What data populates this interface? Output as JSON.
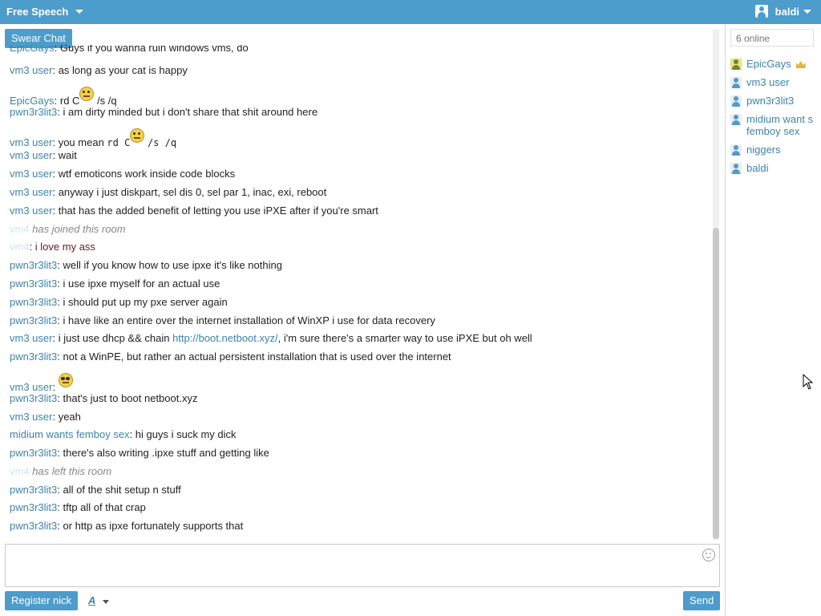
{
  "header": {
    "room_name": "Free Speech",
    "username": "baldi"
  },
  "chat": {
    "swear_button_label": "Swear Chat",
    "messages": [
      {
        "nick": "EpicGays",
        "text": "Guys if you wanna ruin windows vms, do"
      },
      {
        "nick": "vm3 user",
        "text": "as long as your cat is happy"
      },
      {
        "nick": "EpicGays",
        "text_before": "rd C",
        "text_after": "/s /q",
        "emoji": "confused-smiley"
      },
      {
        "nick": "pwn3r3lit3",
        "text": "i am dirty minded but i don't share that shit around here"
      },
      {
        "nick": "vm3 user",
        "text_before": "you mean",
        "code_before": "rd C",
        "code_after": "/s /q",
        "emoji": "confused-smiley"
      },
      {
        "nick": "vm3 user",
        "text": "wait"
      },
      {
        "nick": "vm3 user",
        "text": "wtf emoticons work inside code blocks"
      },
      {
        "nick": "vm3 user",
        "text": "anyway i just diskpart, sel dis 0, sel par 1, inac, exi, reboot"
      },
      {
        "nick": "vm3 user",
        "text": "that has the added benefit of letting you use iPXE after if you're smart"
      },
      {
        "nick": "vm4",
        "event": "has joined this room"
      },
      {
        "nick": "vm4",
        "text": "i love my ass"
      },
      {
        "nick": "pwn3r3lit3",
        "text": "well if you know how to use ipxe it's like nothing"
      },
      {
        "nick": "pwn3r3lit3",
        "text": "i use ipxe myself for an actual use"
      },
      {
        "nick": "pwn3r3lit3",
        "text": "i should put up my pxe server again"
      },
      {
        "nick": "pwn3r3lit3",
        "text": "i have like an entire over the internet installation of WinXP i use for data recovery"
      },
      {
        "nick": "vm3 user",
        "text_before": "i just use dhcp && chain",
        "link": "http://boot.netboot.xyz/",
        "text_after": ", i'm sure there's a smarter way to use iPXE but oh well"
      },
      {
        "nick": "pwn3r3lit3",
        "text": "not a WinPE, but rather an actual persistent installation that is used over the internet"
      },
      {
        "nick": "vm3 user",
        "emoji": "cool-smiley"
      },
      {
        "nick": "pwn3r3lit3",
        "text": "that's just to boot netboot.xyz"
      },
      {
        "nick": "vm3 user",
        "text": "yeah"
      },
      {
        "nick": "midium wants femboy sex",
        "text": "hi guys i suck my dick"
      },
      {
        "nick": "pwn3r3lit3",
        "text": "there's also writing .ipxe stuff and getting like"
      },
      {
        "nick": "vm4",
        "event": "has left this room"
      },
      {
        "nick": "pwn3r3lit3",
        "text": "all of the shit setup n stuff"
      },
      {
        "nick": "pwn3r3lit3",
        "text": "tftp all of that crap"
      },
      {
        "nick": "pwn3r3lit3",
        "text": "or http as ipxe fortunately supports that"
      }
    ]
  },
  "composer": {
    "input_value": "",
    "register_label": "Register nick",
    "format_label": "A",
    "send_label": "Send"
  },
  "sidebar": {
    "online_count": "6 online",
    "users": [
      {
        "name": "EpicGays",
        "icon": "user-gold-icon",
        "badge": "crown-icon"
      },
      {
        "name": "vm3 user",
        "icon": "user-icon"
      },
      {
        "name": "pwn3r3lit3",
        "icon": "user-icon"
      },
      {
        "name": "midium want s femboy sex",
        "icon": "user-icon"
      },
      {
        "name": "niggers",
        "icon": "user-icon"
      },
      {
        "name": "baldi",
        "icon": "user-icon"
      }
    ]
  },
  "colors": {
    "header_bg": "#4c9ccc",
    "nick": "#3e83a8",
    "button_bg": "#4c9ccc"
  }
}
